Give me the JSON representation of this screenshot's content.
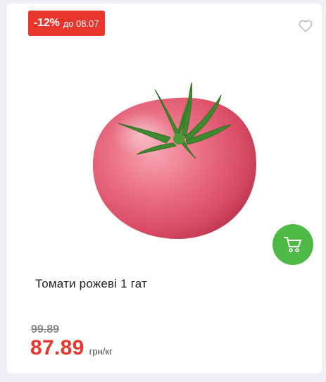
{
  "badge": {
    "discount": "-12%",
    "valid_until": "до 08.07",
    "color": "#e8362d"
  },
  "favorite": {
    "icon": "heart-outline-icon"
  },
  "product": {
    "name": "Томати рожеві 1 гат",
    "image_icon": "tomato-image"
  },
  "cart": {
    "icon": "cart-icon",
    "color": "#4fb945"
  },
  "price": {
    "old": "99.89",
    "current": "87.89",
    "unit": "грн/кг"
  }
}
